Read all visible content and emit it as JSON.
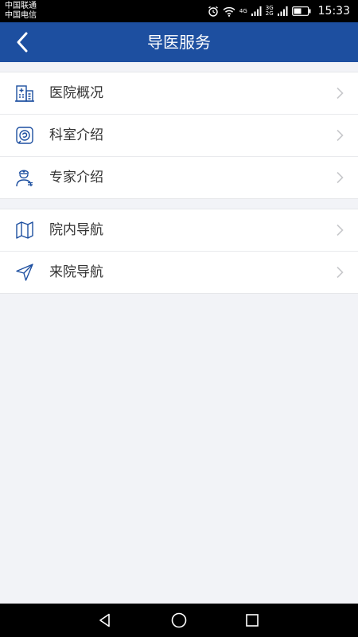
{
  "status_bar": {
    "carrier_1": "中国联通",
    "carrier_2": "中国电信",
    "network_1": "4G",
    "network_2a": "3G",
    "network_2b": "2G",
    "time": "15:33"
  },
  "header": {
    "title": "导医服务"
  },
  "menu_groups": [
    {
      "items": [
        {
          "label": "医院概况",
          "icon": "hospital-building-icon"
        },
        {
          "label": "科室介绍",
          "icon": "department-icon"
        },
        {
          "label": "专家介绍",
          "icon": "doctor-icon"
        }
      ]
    },
    {
      "items": [
        {
          "label": "院内导航",
          "icon": "map-icon"
        },
        {
          "label": "来院导航",
          "icon": "navigation-arrow-icon"
        }
      ]
    }
  ],
  "colors": {
    "header_bg": "#1d4fa0",
    "icon_color": "#1d4fa0",
    "page_bg": "#f2f3f7"
  }
}
